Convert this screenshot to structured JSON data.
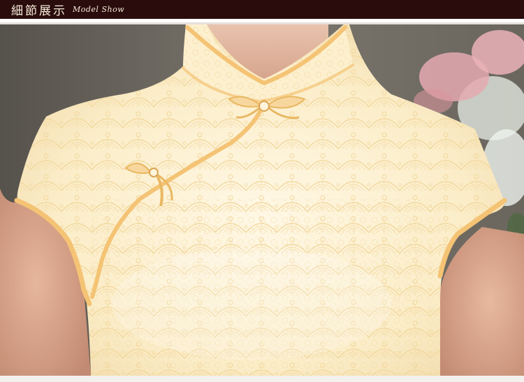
{
  "header": {
    "title": "細節展示",
    "subtitle": "Model Show"
  },
  "colors": {
    "header_bg": "#2a0c0c",
    "header_text": "#f4ead8",
    "dress_lace": "#fbedc6",
    "piping": "#f3c26f",
    "background_wall": "#6e6a62",
    "skin": "#d9a48a"
  },
  "icons": {
    "frog_button_upper": "knot-button",
    "frog_button_lower": "knot-button"
  }
}
